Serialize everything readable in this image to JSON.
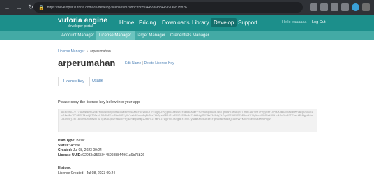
{
  "browser": {
    "url": "https://developer.vuforia.com/vui/develop/licenses/92083c356504459698844961a6b75b26",
    "extension_colors": [
      "#7c7f85",
      "#7c7f85",
      "#7c7f85",
      "#7c7f85",
      "#7c7f85",
      "#e6e6e6",
      "#3aa0d8",
      "#6e6e6e"
    ]
  },
  "header": {
    "logo_main": "vuforia engine",
    "logo_sub": "developer portal",
    "nav": [
      {
        "label": "Home"
      },
      {
        "label": "Pricing"
      },
      {
        "label": "Downloads"
      },
      {
        "label": "Library"
      },
      {
        "label": "Develop"
      },
      {
        "label": "Support"
      }
    ],
    "active_nav": "Develop",
    "user_label": "Hello eaaaaaa",
    "logout_label": "Log Out"
  },
  "subnav": {
    "items": [
      {
        "label": "Account Manager"
      },
      {
        "label": "License Manager"
      },
      {
        "label": "Target Manager"
      },
      {
        "label": "Credentials Manager"
      }
    ],
    "active": "License Manager"
  },
  "breadcrumb": {
    "parent": "License Manager",
    "separator": "›",
    "current": "arperumahan"
  },
  "license": {
    "title": "arperumahan",
    "edit_link": "Edit Name",
    "delete_link": "Delete License Key",
    "tabs": [
      {
        "label": "License Key"
      },
      {
        "label": "Usage"
      }
    ],
    "active_tab": "License Key",
    "instruction": "Please copy the license key below into your app",
    "key": "AUz7mrD/////AAABmWzPCvEkfMkBSWpkngb0NwE8wHtVzS6aXNEfVdV0ACnTFc1QngZvOjqKSxAeASnxfNWbBeAbmfrfuvnuPqpBGDE7W8TgFbBPEBNSEqR/THMBEaAFVHY7PeyyMsfLvPMOKYWUzbbXDamMvuWZpDsE3xic7Aa9RsTDCOP7XZAzdQ8ZO5sbXJHVRmEFiwSHn9GP7yUu7wmV85wcw8qBkT6sTXbZyz0GBPiTAoS9YGiEMRs0o7k6W8dgMTYZMeXA1BdqYtZzp/ElWh5VEZoR8ovtVJ0yNovVJOfMskV9HJvA9xEGc87TI3mxkRtNgp+AiwJB3RDdjIx7iacXHBOhkKe9BTRzTgiAaCyEwFRasdEvYjWzrMmp4emp2J0bFkJ/PmrAl+IQbYpL4sYgNEYZnvZIyNAWHXB0c3f4ekYqHvlwWzNAseQEqDMvVYKpCrb6evUGzaMe9PmpV",
    "plan_type_label": "Plan Type:",
    "plan_type": "Basic",
    "status_label": "Status:",
    "status": "Active",
    "created_label": "Created:",
    "created": "Jul 08, 2023 09:24",
    "uuid_label": "License UUID:",
    "uuid": "92083c356504459698844961a6b75b26",
    "history_label": "History:",
    "history_entry": "License Created - Jul 08, 2023 09:24"
  }
}
